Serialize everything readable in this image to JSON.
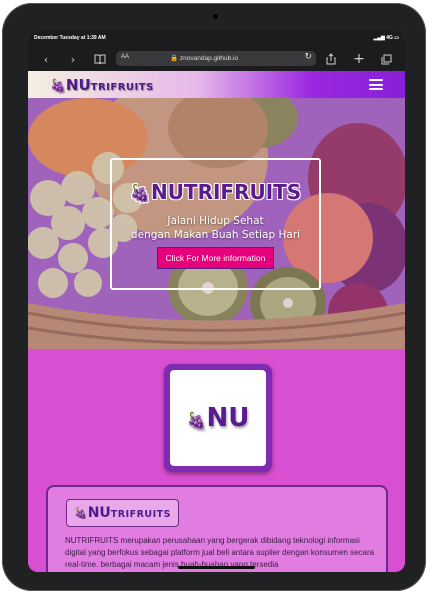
{
  "statusbar": {
    "time": "December Tuesday at 1:39 AM",
    "signal": "4G"
  },
  "browser": {
    "reader_label": "AA",
    "url": "znovandap.github.io",
    "back_icon": "chevron-left-icon",
    "forward_icon": "chevron-right-icon",
    "bookmarks_icon": "book-icon",
    "reload_icon": "reload-icon",
    "share_icon": "share-icon",
    "new_tab_icon": "plus-icon",
    "tabs_icon": "tabs-icon"
  },
  "navbar": {
    "brand_big": "NU",
    "brand_small": "TRIFRUITS",
    "menu_icon": "hamburger-icon"
  },
  "hero": {
    "title": "NUTRIFRUITS",
    "tagline_1": "Jalani Hidup Sehat",
    "tagline_2": "dengan Makan Buah Setiap Hari",
    "button_label": "Click For More information"
  },
  "logo": {
    "text": "NU"
  },
  "about": {
    "brand_big": "NU",
    "brand_small": "TRIFRUITS",
    "text": "NUTRIFRUITS merupakan perusahaan yang bergerak dibidang teknologi informasi digital yang berfokus sebagai platform jual beli antara suplier dengan konsumen secara real-time. berbagai macam jenis buah-buahan yang tersedia"
  },
  "colors": {
    "brand": "#5a1a90",
    "accent": "#e6007a",
    "section_bg": "#d94fd1"
  }
}
